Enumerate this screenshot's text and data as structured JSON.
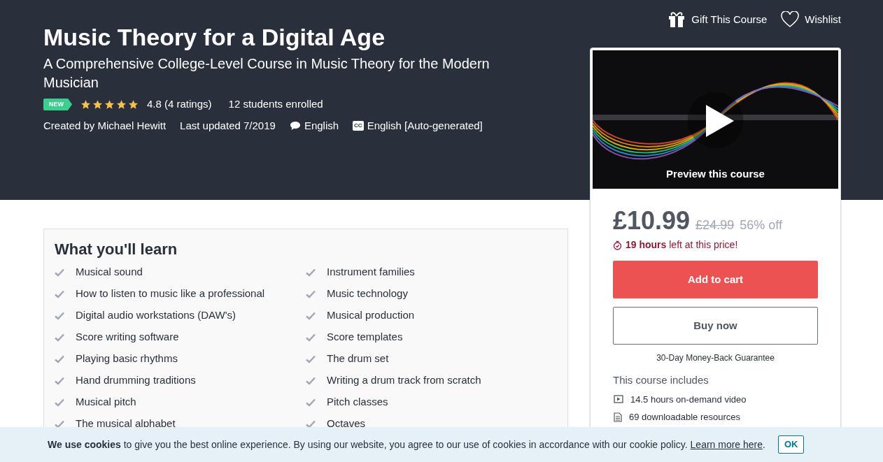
{
  "top_links": [
    {
      "kind": "gift",
      "label": "Gift This Course"
    },
    {
      "kind": "wishlist",
      "label": "Wishlist"
    }
  ],
  "title": "Music Theory for a Digital Age",
  "subtitle": "A Comprehensive College-Level Course in Music Theory for the Modern Musician",
  "badge": "NEW",
  "rating": {
    "stars": 5,
    "text": "4.8 (4 ratings)"
  },
  "enrolled": "12 students enrolled",
  "meta": [
    {
      "kind": "text",
      "label": "Created by Michael Hewitt"
    },
    {
      "kind": "text",
      "label": "Last updated 7/2019"
    },
    {
      "kind": "language",
      "label": "English"
    },
    {
      "kind": "captions",
      "label": "English [Auto-generated]",
      "icon_text": "CC"
    }
  ],
  "preview": {
    "label": "Preview this course"
  },
  "price": {
    "current": "£10.99",
    "original": "£24.99",
    "discount": "56% off"
  },
  "timer": "**19 hours** left at this price!",
  "buttons": [
    {
      "kind": "primary",
      "label": "Add to cart"
    },
    {
      "kind": "outline",
      "label": "Buy now"
    }
  ],
  "guarantee": "30-Day Money-Back Guarantee",
  "includes": {
    "title": "This course includes",
    "items": [
      {
        "kind": "video",
        "label": "14.5 hours on-demand video"
      },
      {
        "kind": "file",
        "label": "69 downloadable resources"
      }
    ]
  },
  "learn": {
    "title": "What you'll learn",
    "items": [
      "Musical sound",
      "Instrument families",
      "How to listen to music like a professional",
      "Music technology",
      "Digital audio workstations (DAW's)",
      "Musical production",
      "Score writing software",
      "Score templates",
      "Playing basic rhythms",
      "The drum set",
      "Hand drumming traditions",
      "Writing a drum track from scratch",
      "Musical pitch",
      "Pitch classes",
      "The musical alphabet",
      "Octaves"
    ]
  },
  "cookie": {
    "text": "**We use cookies** to give you the best online experience. By using our website, you agree to our use of cookies in accordance with our cookie policy.",
    "link": "Learn more here",
    "link_end": ".",
    "button": "OK"
  }
}
